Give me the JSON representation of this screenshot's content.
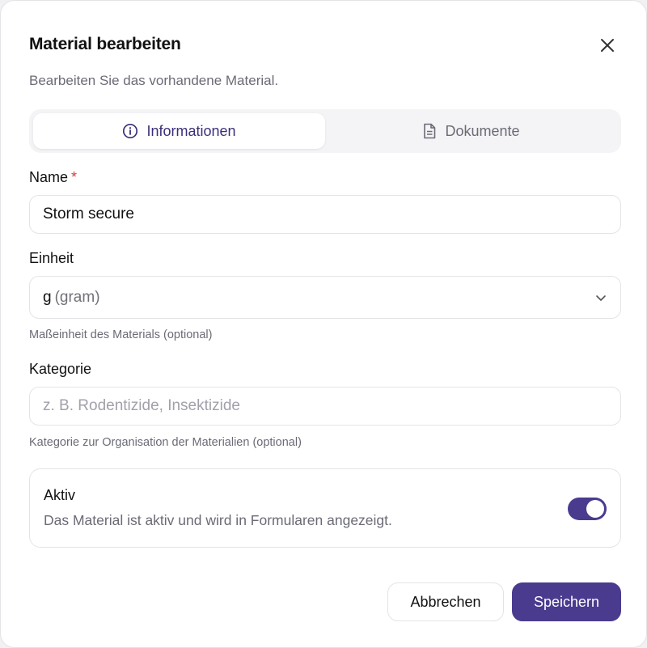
{
  "dialog": {
    "title": "Material bearbeiten",
    "subtitle": "Bearbeiten Sie das vorhandene Material.",
    "close_icon": "close-icon"
  },
  "tabs": [
    {
      "label": "Informationen",
      "icon": "info-icon",
      "active": true
    },
    {
      "label": "Dokumente",
      "icon": "document-icon",
      "active": false
    }
  ],
  "form": {
    "name": {
      "label": "Name",
      "required_mark": "*",
      "value": "Storm secure"
    },
    "unit": {
      "label": "Einheit",
      "value_main": "g",
      "value_sub": "(gram)",
      "hint": "Maßeinheit des Materials (optional)"
    },
    "category": {
      "label": "Kategorie",
      "placeholder": "z. B. Rodentizide, Insektizide",
      "value": "",
      "hint": "Kategorie zur Organisation der Materialien (optional)"
    },
    "active": {
      "title": "Aktiv",
      "description": "Das Material ist aktiv und wird in Formularen angezeigt.",
      "enabled": true
    }
  },
  "actions": {
    "cancel_label": "Abbrechen",
    "save_label": "Speichern"
  },
  "colors": {
    "accent": "#4a3b8f",
    "required": "#d63b3b"
  }
}
